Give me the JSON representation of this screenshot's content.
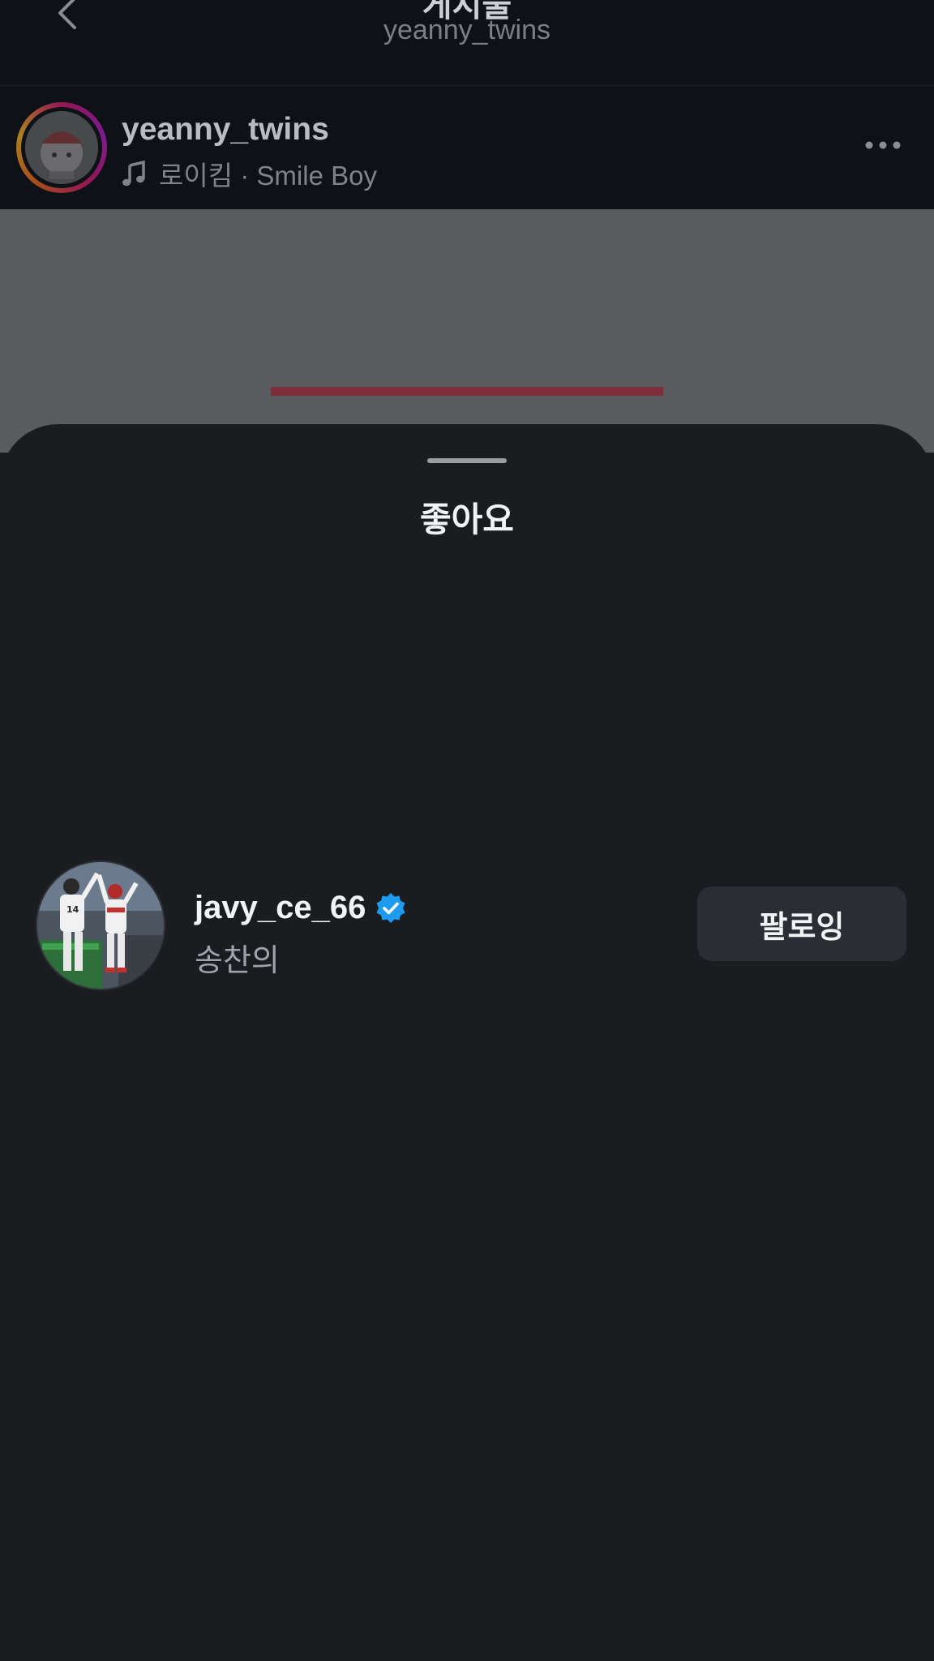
{
  "nav": {
    "title": "게시물",
    "subtitle": "yeanny_twins"
  },
  "post": {
    "username": "yeanny_twins",
    "audio": "로이킴 · Smile Boy"
  },
  "sheet": {
    "title": "좋아요"
  },
  "likes": [
    {
      "username": "javy_ce_66",
      "full_name": "송찬의",
      "verified": true,
      "button_label": "팔로잉"
    }
  ],
  "colors": {
    "background": "#1a1c20",
    "verified": "#1d9bf0",
    "follow_button": "#2a2d34",
    "media_overlay": "#595b5e"
  },
  "icons": [
    "back-icon",
    "music-icon",
    "more-icon",
    "verified-icon"
  ]
}
